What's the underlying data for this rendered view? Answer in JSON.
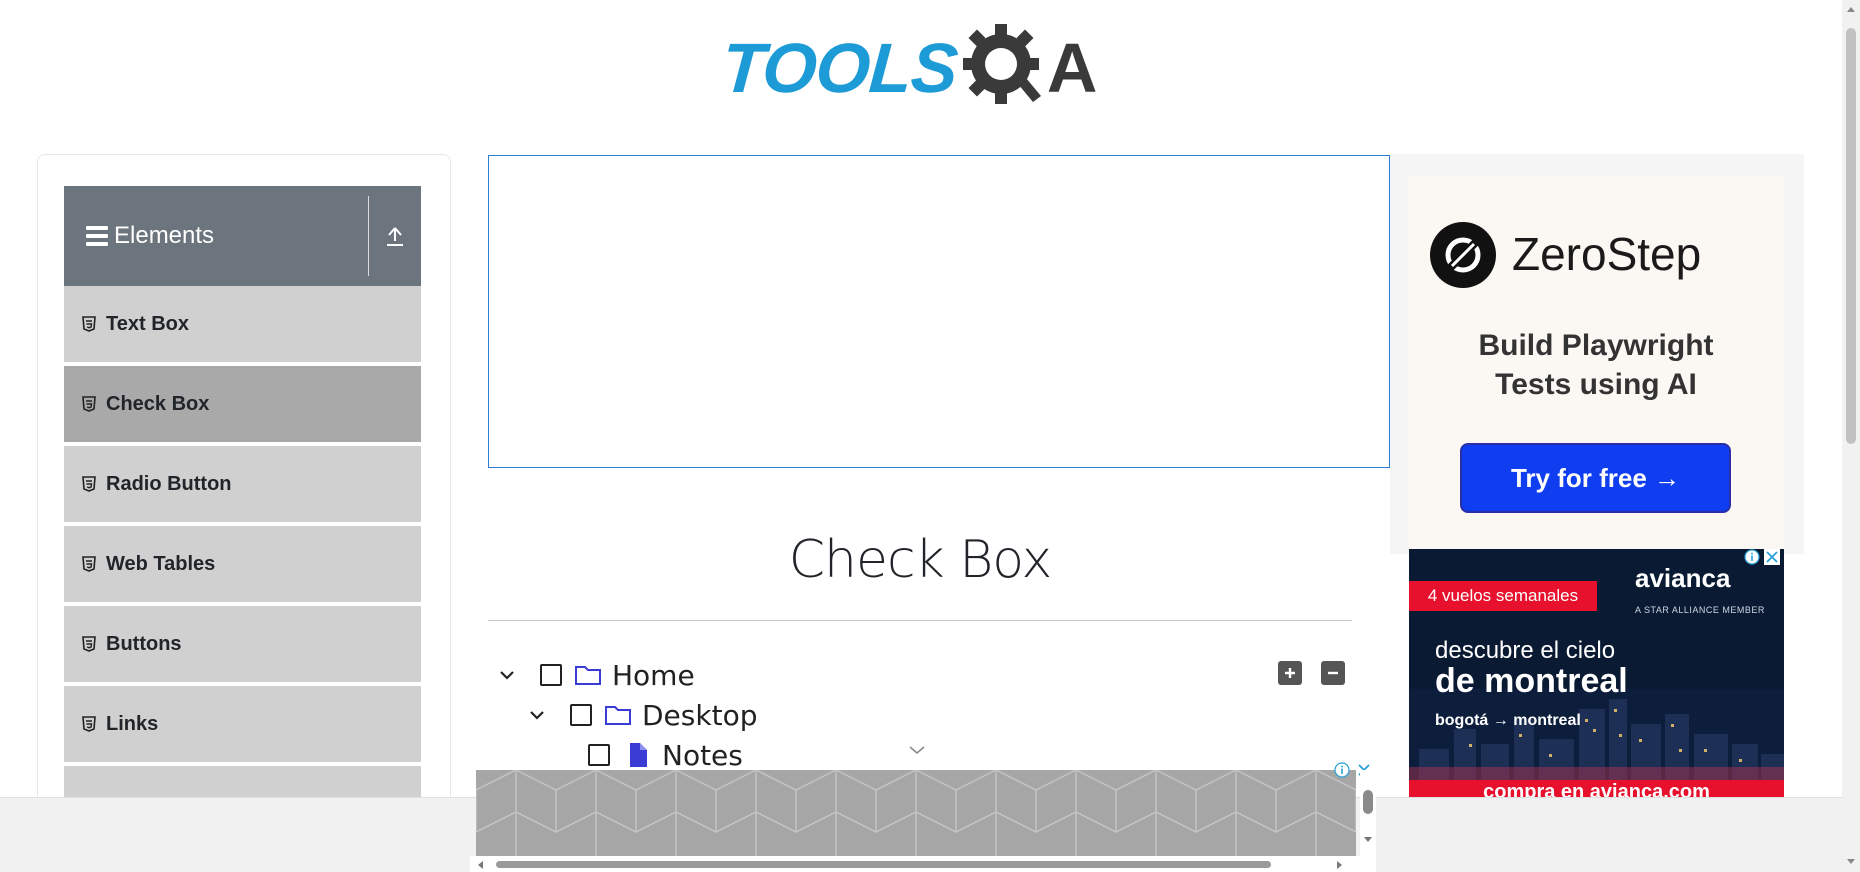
{
  "brand": {
    "logo_left": "TOOLS",
    "logo_right": "A",
    "colors": {
      "primary": "#1d9bd6",
      "dark": "#3a3a3a"
    }
  },
  "sidebar": {
    "group_title": "Elements",
    "group_icon": "hamburger-icon",
    "collapse_icon": "upload-icon",
    "items": [
      {
        "label": "Text Box",
        "icon": "html5-icon",
        "active": false
      },
      {
        "label": "Check Box",
        "icon": "html5-icon",
        "active": true
      },
      {
        "label": "Radio Button",
        "icon": "html5-icon",
        "active": false
      },
      {
        "label": "Web Tables",
        "icon": "html5-icon",
        "active": false
      },
      {
        "label": "Buttons",
        "icon": "html5-icon",
        "active": false
      },
      {
        "label": "Links",
        "icon": "html5-icon",
        "active": false
      }
    ]
  },
  "main": {
    "title": "Check Box",
    "tree": [
      {
        "label": "Home",
        "icon": "folder-icon",
        "expanded": true,
        "checked": false
      },
      {
        "label": "Desktop",
        "icon": "folder-icon",
        "expanded": true,
        "checked": false
      },
      {
        "label": "Notes",
        "icon": "file-icon",
        "expanded": false,
        "checked": false
      }
    ],
    "expand_all_icon": "plus-square-icon",
    "collapse_all_icon": "minus-square-icon"
  },
  "ads": {
    "zerostep": {
      "name": "ZeroStep",
      "tagline_1": "Build Playwright",
      "tagline_2": "Tests using AI",
      "cta": "Try for free →",
      "colors": {
        "cta": "#0f3ef0"
      }
    },
    "avianca": {
      "badge": "4 vuelos semanales",
      "brand": "avianca",
      "member": "A STAR ALLIANCE MEMBER",
      "headline_1": "descubre el cielo",
      "headline_2": "de montreal",
      "route": "bogotá → montreal",
      "cta": "compra en avianca.com",
      "colors": {
        "red": "#e8112d",
        "navy": "#0b1a33"
      }
    }
  }
}
